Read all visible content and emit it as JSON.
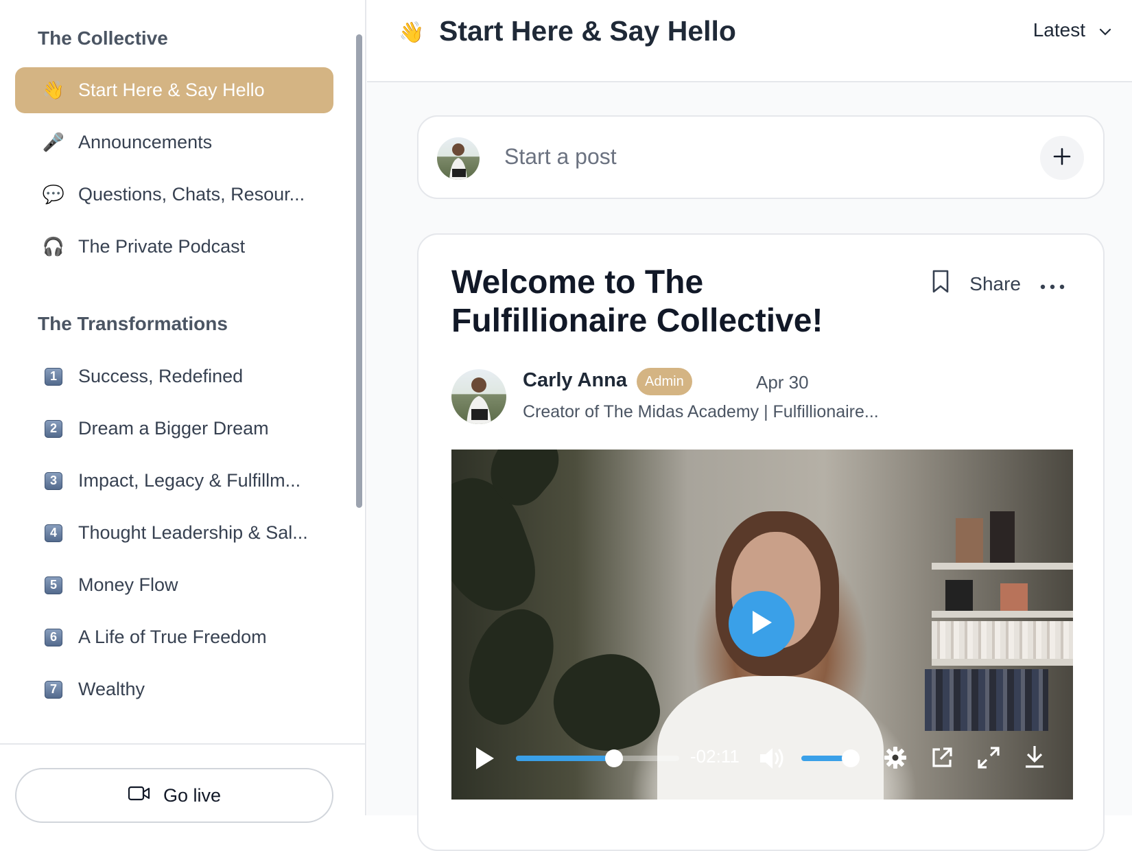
{
  "sidebar": {
    "section1_title": "The Collective",
    "section1_items": [
      {
        "icon": "👋",
        "label": "Start Here & Say Hello",
        "active": true
      },
      {
        "icon": "🎤",
        "label": "Announcements"
      },
      {
        "icon": "💬",
        "label": "Questions, Chats, Resour..."
      },
      {
        "icon": "🎧",
        "label": "The Private Podcast"
      }
    ],
    "section2_title": "The Transformations",
    "section2_items": [
      {
        "num": "1",
        "label": "Success, Redefined"
      },
      {
        "num": "2",
        "label": "Dream a Bigger Dream"
      },
      {
        "num": "3",
        "label": "Impact, Legacy & Fulfillm..."
      },
      {
        "num": "4",
        "label": "Thought Leadership & Sal..."
      },
      {
        "num": "5",
        "label": "Money Flow"
      },
      {
        "num": "6",
        "label": "A Life of True Freedom"
      },
      {
        "num": "7",
        "label": "Wealthy"
      }
    ],
    "go_live_label": "Go live"
  },
  "header": {
    "emoji": "👋",
    "title": "Start Here & Say Hello",
    "sort_label": "Latest"
  },
  "composer": {
    "placeholder": "Start a post"
  },
  "post": {
    "title": "Welcome to The Fulfillionaire Collective!",
    "share_label": "Share",
    "author": {
      "name": "Carly Anna",
      "badge": "Admin",
      "date": "Apr 30",
      "subtitle": "Creator of The Midas Academy | Fulfillionaire..."
    },
    "video": {
      "time_remaining": "-02:11",
      "progress": 0.6,
      "volume": 0.92
    }
  },
  "colors": {
    "accent": "#d4b483",
    "play_blue": "#3aa0e8"
  }
}
